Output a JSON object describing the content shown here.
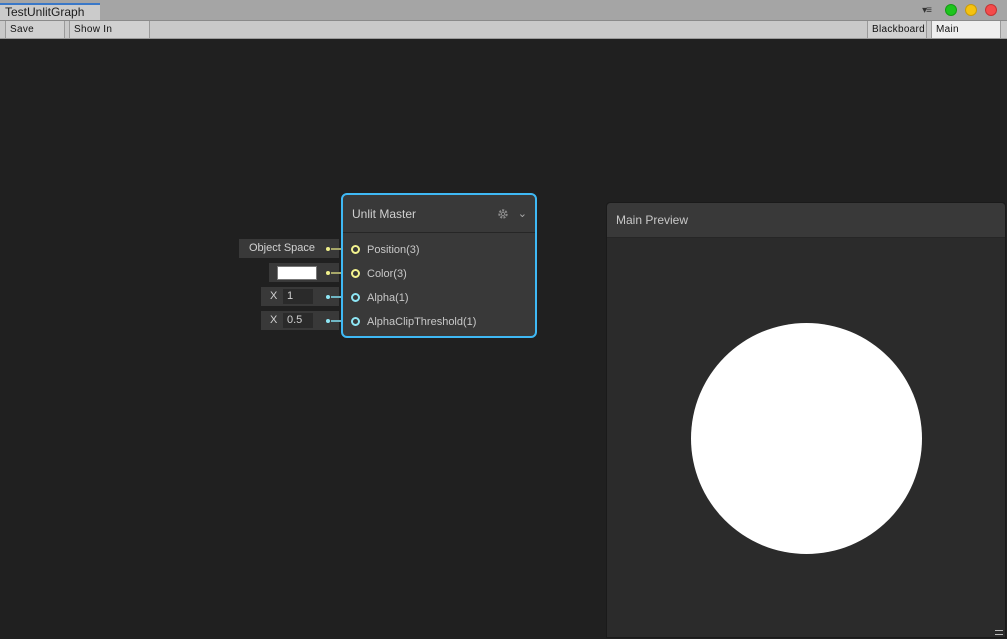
{
  "window": {
    "tab_title": "TestUnlitGraph",
    "controls": {
      "menu_icon": "menu-icon",
      "green": "#1dc51d",
      "yellow": "#f5c20f",
      "red": "#f44b4b"
    }
  },
  "toolbar": {
    "save_asset": "Save Asset",
    "show_in_project": "Show In Project",
    "blackboard": "Blackboard",
    "main_preview": "Main Preview"
  },
  "inputs": {
    "position_space": "Object Space",
    "color_value": "#ffffff",
    "alpha_axis": "X",
    "alpha_value": "1",
    "clip_axis": "X",
    "clip_value": "0.5"
  },
  "node": {
    "title": "Unlit Master",
    "accent": "#3fb9f5",
    "slots": [
      {
        "label": "Position(3)",
        "type": "vector3"
      },
      {
        "label": "Color(3)",
        "type": "vector3"
      },
      {
        "label": "Alpha(1)",
        "type": "vector1"
      },
      {
        "label": "AlphaClipThreshold(1)",
        "type": "vector1"
      }
    ],
    "icons": {
      "settings": "gear-icon",
      "collapse": "chevron-down-icon"
    }
  },
  "preview": {
    "title": "Main Preview",
    "sphere_color": "#ffffff"
  }
}
